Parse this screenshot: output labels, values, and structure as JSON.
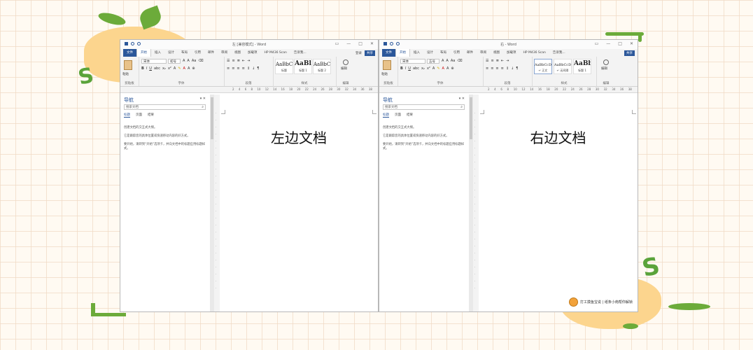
{
  "left_window": {
    "title": "左 [兼容模式] - Word",
    "tabs": [
      "文件",
      "开始",
      "插入",
      "设计",
      "布局",
      "引用",
      "邮件",
      "审阅",
      "视图",
      "加载项",
      "HP M436 Scan",
      "告诉我..."
    ],
    "login": "登录",
    "share": "共享",
    "ribbon": {
      "paste": "粘贴",
      "font_name": "宋体",
      "font_size": "初号",
      "groups": [
        "剪贴板",
        "字体",
        "段落",
        "样式",
        "编辑"
      ],
      "styles": [
        {
          "sample": "AaBbC",
          "name": "标题"
        },
        {
          "sample": "AaBl",
          "name": "标题 1"
        },
        {
          "sample": "AaBbC",
          "name": "标题 2"
        }
      ],
      "edit": "编辑"
    },
    "nav": {
      "title": "导航",
      "search_placeholder": "搜索文档",
      "tabs": [
        "标题",
        "页面",
        "结果"
      ],
      "text": [
        "创建文档的交互式大纲。",
        "它是跟踪您的具体位置或快速移动内容的好方式。",
        "要开始，请转到“开始”选项卡，并向文档中的标题应用标题样式。"
      ]
    },
    "doc_text": "左边文档"
  },
  "right_window": {
    "title": "右 - Word",
    "tabs": [
      "文件",
      "开始",
      "插入",
      "设计",
      "布局",
      "引用",
      "邮件",
      "审阅",
      "视图",
      "加载项",
      "HP M436 Scan",
      "告诉我..."
    ],
    "share": "共享",
    "ribbon": {
      "paste": "粘贴",
      "font_name": "宋体",
      "font_size": "五号",
      "groups": [
        "剪贴板",
        "字体",
        "段落",
        "样式",
        "编辑"
      ],
      "styles": [
        {
          "sample": "AaBbCcDd",
          "name": "↵ 正文"
        },
        {
          "sample": "AaBbCcDd",
          "name": "↵ 无间隔"
        },
        {
          "sample": "AaBb",
          "name": "标题 1"
        }
      ],
      "edit": "编辑"
    },
    "nav": {
      "title": "导航",
      "search_placeholder": "搜索文档",
      "tabs": [
        "标题",
        "页面",
        "结果"
      ],
      "text": [
        "创建文档的交互式大纲。",
        "它是跟踪您的具体位置或快速移动内容的好方式。",
        "要开始，请转到“开始”选项卡，并向文档中的标题应用标题样式。"
      ]
    },
    "doc_text": "右边文档"
  },
  "ruler_numbers": [
    "2",
    "4",
    "6",
    "8",
    "10",
    "12",
    "14",
    "16",
    "18",
    "20",
    "22",
    "24",
    "26",
    "28",
    "30",
    "32",
    "34",
    "36",
    "38"
  ],
  "watermark": "打工摸鱼宝说 | 纸条小南帮你解锁",
  "colors": {
    "word_blue": "#2b579a",
    "ribbon_bg": "#f3f3f3",
    "leaf_green": "#6cab3a",
    "blob_orange": "#fcd58e"
  }
}
